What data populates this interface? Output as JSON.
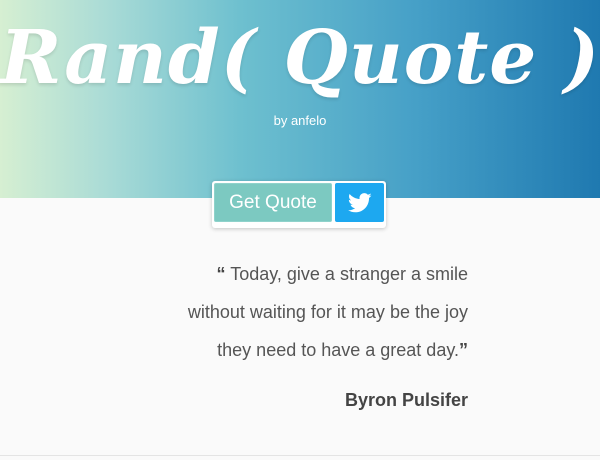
{
  "header": {
    "title": "Rand( Quote )",
    "byline": "by anfelo"
  },
  "actions": {
    "get_quote_label": "Get Quote",
    "tweet_icon": "twitter-bird-icon"
  },
  "quote": {
    "open_mark": "“",
    "lines": [
      " Today, give a stranger a smile",
      "without waiting for it may be the joy",
      "they need to have a great day."
    ],
    "close_mark": "”",
    "author": "Byron Pulsifer"
  },
  "colors": {
    "gradient_start": "#d6efd2",
    "gradient_end": "#1f79b0",
    "get_quote_bg": "#7cc9c1",
    "tweet_bg": "#1da8f0",
    "quote_text": "#555555"
  }
}
